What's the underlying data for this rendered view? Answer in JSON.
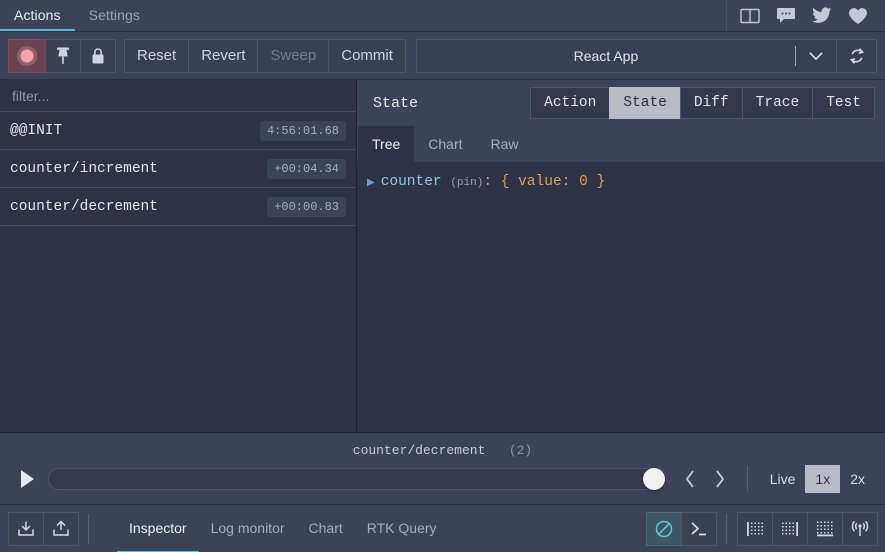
{
  "topbar": {
    "tabs": [
      {
        "label": "Actions",
        "active": true
      },
      {
        "label": "Settings",
        "active": false
      }
    ],
    "icons": [
      {
        "name": "book-icon",
        "title": "Documentation"
      },
      {
        "name": "chat-icon",
        "title": "Chat"
      },
      {
        "name": "twitter-icon",
        "title": "Twitter"
      },
      {
        "name": "heart-icon",
        "title": "Support"
      }
    ]
  },
  "toolbar": {
    "record_label": "record-toggle",
    "pin_label": "pin",
    "lock_label": "lock",
    "reset_label": "Reset",
    "revert_label": "Revert",
    "sweep_label": "Sweep",
    "commit_label": "Commit",
    "instance_name": "React App",
    "refresh_label": "refresh"
  },
  "actions_panel": {
    "filter_placeholder": "filter...",
    "filter_value": "",
    "rows": [
      {
        "name": "@@INIT",
        "time": "4:56:01.68"
      },
      {
        "name": "counter/increment",
        "time": "+00:04.34"
      },
      {
        "name": "counter/decrement",
        "time": "+00:00.83"
      }
    ]
  },
  "inspector": {
    "title": "State",
    "tabs": [
      {
        "label": "Action",
        "active": false
      },
      {
        "label": "State",
        "active": true
      },
      {
        "label": "Diff",
        "active": false
      },
      {
        "label": "Trace",
        "active": false
      },
      {
        "label": "Test",
        "active": false
      }
    ],
    "subtabs": [
      {
        "label": "Tree",
        "active": true
      },
      {
        "label": "Chart",
        "active": false
      },
      {
        "label": "Raw",
        "active": false
      }
    ],
    "tree": {
      "key": "counter",
      "pin": "(pin)",
      "colon": ":",
      "open_brace": "{",
      "prop": "value:",
      "value": "0",
      "close_brace": "}"
    }
  },
  "slider": {
    "caption_action": "counter/decrement",
    "caption_count": "(2)",
    "play_label": "play",
    "prev_label": "previous-action",
    "next_label": "next-action",
    "live_label": "Live",
    "speeds": [
      {
        "label": "1x",
        "active": true
      },
      {
        "label": "2x",
        "active": false
      }
    ]
  },
  "bottombar": {
    "import_label": "import",
    "export_label": "export",
    "tabs": [
      {
        "label": "Inspector",
        "active": true
      },
      {
        "label": "Log monitor",
        "active": false
      },
      {
        "label": "Chart",
        "active": false
      },
      {
        "label": "RTK Query",
        "active": false
      }
    ],
    "right_buttons": [
      {
        "name": "dispatcher-icon",
        "active": true
      },
      {
        "name": "terminal-icon",
        "active": false
      },
      {
        "name": "dock-left-icon",
        "active": false
      },
      {
        "name": "dock-right-icon",
        "active": false
      },
      {
        "name": "dock-bottom-icon",
        "active": false
      },
      {
        "name": "broadcast-icon",
        "active": false
      }
    ]
  },
  "colors": {
    "chrome": "#3c4257",
    "panel": "#2e3245",
    "accent": "#57bdd6",
    "active_tab_bg": "#b9bcc4",
    "record": "#f29ba8"
  }
}
